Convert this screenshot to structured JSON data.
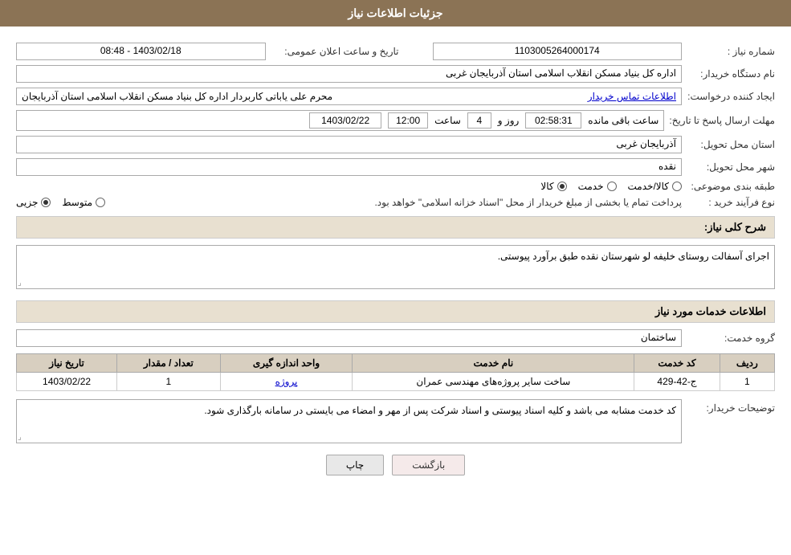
{
  "header": {
    "title": "جزئیات اطلاعات نیاز"
  },
  "fields": {
    "need_number_label": "شماره نیاز :",
    "need_number_value": "1103005264000174",
    "announce_date_label": "تاریخ و ساعت اعلان عمومی:",
    "announce_date_value": "1403/02/18 - 08:48",
    "buyer_org_label": "نام دستگاه خریدار:",
    "buyer_org_value": "اداره کل بنیاد مسکن انقلاب اسلامی استان آذربایجان غربی",
    "creator_label": "ایجاد کننده درخواست:",
    "creator_value": "محرم علی یاباتی کاربردار اداره کل بنیاد مسکن انقلاب اسلامی استان آذربایجان",
    "creator_contact_link": "اطلاعات تماس خریدار",
    "deadline_label": "مهلت ارسال پاسخ تا تاریخ:",
    "deadline_date_value": "1403/02/22",
    "deadline_time_label": "ساعت",
    "deadline_time_value": "12:00",
    "deadline_days_label": "روز و",
    "deadline_days_value": "4",
    "deadline_remaining_label": "ساعت باقی مانده",
    "deadline_remaining_value": "02:58:31",
    "province_label": "استان محل تحویل:",
    "province_value": "آذربایجان غربی",
    "city_label": "شهر محل تحویل:",
    "city_value": "نقده",
    "category_label": "طبقه بندی موضوعی:",
    "category_options": [
      "کالا",
      "خدمت",
      "کالا/خدمت"
    ],
    "category_selected": "کالا",
    "purchase_type_label": "نوع فرآیند خرید :",
    "purchase_type_options": [
      "جزیی",
      "متوسط"
    ],
    "purchase_type_note": "پرداخت تمام یا بخشی از مبلغ خریدار از محل \"اسناد خزانه اسلامی\" خواهد بود.",
    "description_section_label": "شرح کلی نیاز:",
    "description_value": "اجرای آسفالت روستای خلیفه لو شهرستان نقده طبق برآورد پیوستی.",
    "services_section_title": "اطلاعات خدمات مورد نیاز",
    "service_group_label": "گروه خدمت:",
    "service_group_value": "ساختمان",
    "table": {
      "headers": [
        "ردیف",
        "کد خدمت",
        "نام خدمت",
        "واحد اندازه گیری",
        "تعداد / مقدار",
        "تاریخ نیاز"
      ],
      "rows": [
        {
          "row": "1",
          "code": "ج-42-429",
          "name": "ساخت سایر پروژه‌های مهندسی عمران",
          "unit": "پروژه",
          "qty": "1",
          "date": "1403/02/22"
        }
      ]
    },
    "buyer_desc_label": "توضیحات خریدار:",
    "buyer_desc_value": "کد خدمت مشابه می باشد و کلیه اسناد پیوستی و اسناد شرکت پس از مهر و امضاء می بایستی در سامانه بارگذاری شود.",
    "btn_print": "چاپ",
    "btn_back": "بازگشت"
  }
}
